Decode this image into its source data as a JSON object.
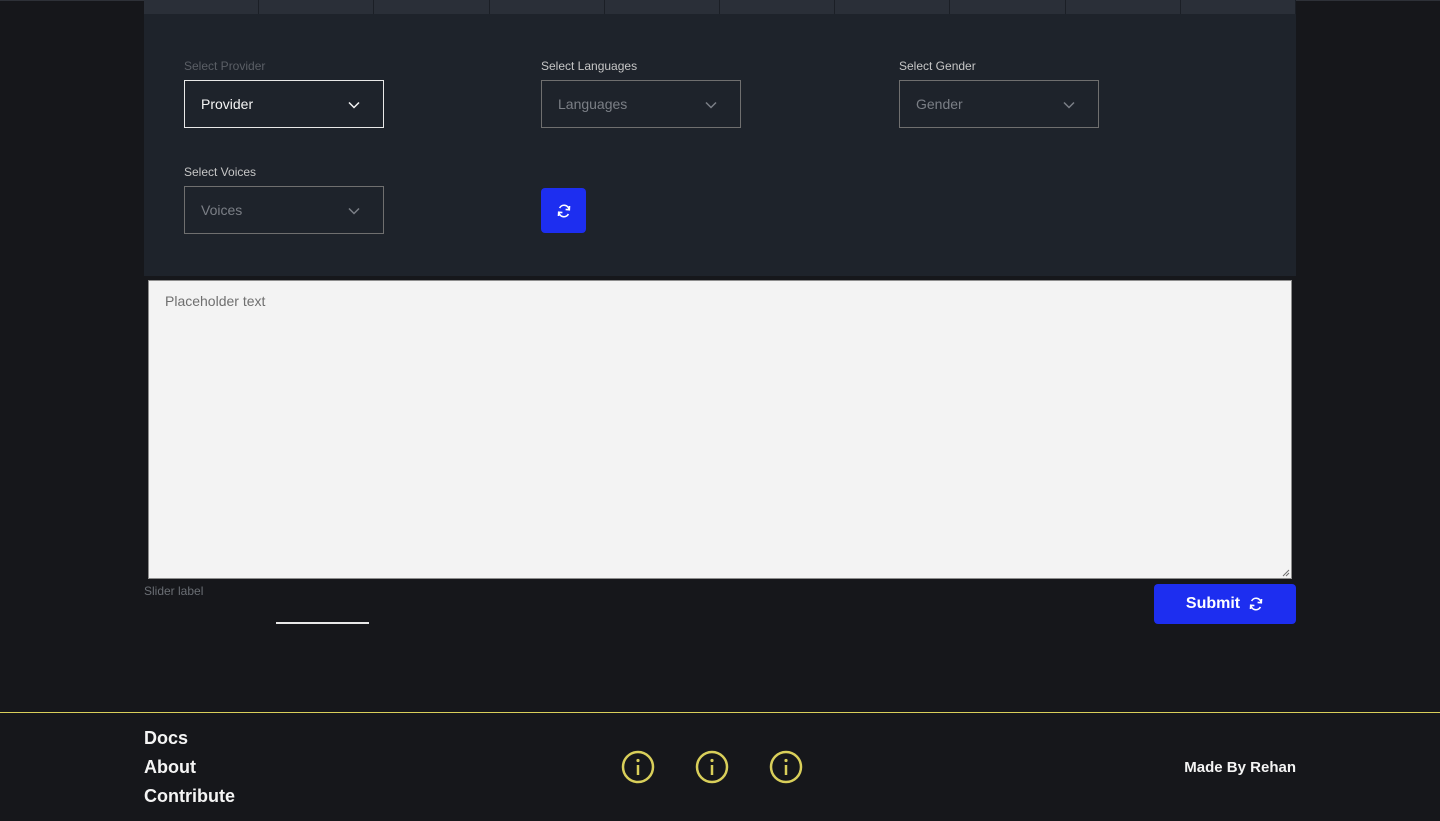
{
  "form": {
    "provider": {
      "label": "Select Provider",
      "value": "Provider"
    },
    "languages": {
      "label": "Select Languages",
      "value": "Languages"
    },
    "gender": {
      "label": "Select Gender",
      "value": "Gender"
    },
    "voices": {
      "label": "Select Voices",
      "value": "Voices"
    },
    "refresh_icon": "refresh-icon"
  },
  "text_input": {
    "placeholder": "Placeholder text"
  },
  "slider": {
    "label": "Slider label"
  },
  "submit": {
    "label": "Submit",
    "icon": "refresh-icon"
  },
  "footer": {
    "links": [
      "Docs",
      "About",
      "Contribute"
    ],
    "icons": [
      "info-icon",
      "info-icon",
      "info-icon"
    ],
    "credit": "Made By Rehan"
  },
  "colors": {
    "accent": "#1d2ef0",
    "footer_accent": "#d9cf5a",
    "panel": "#1e232b",
    "background": "#16171b"
  }
}
